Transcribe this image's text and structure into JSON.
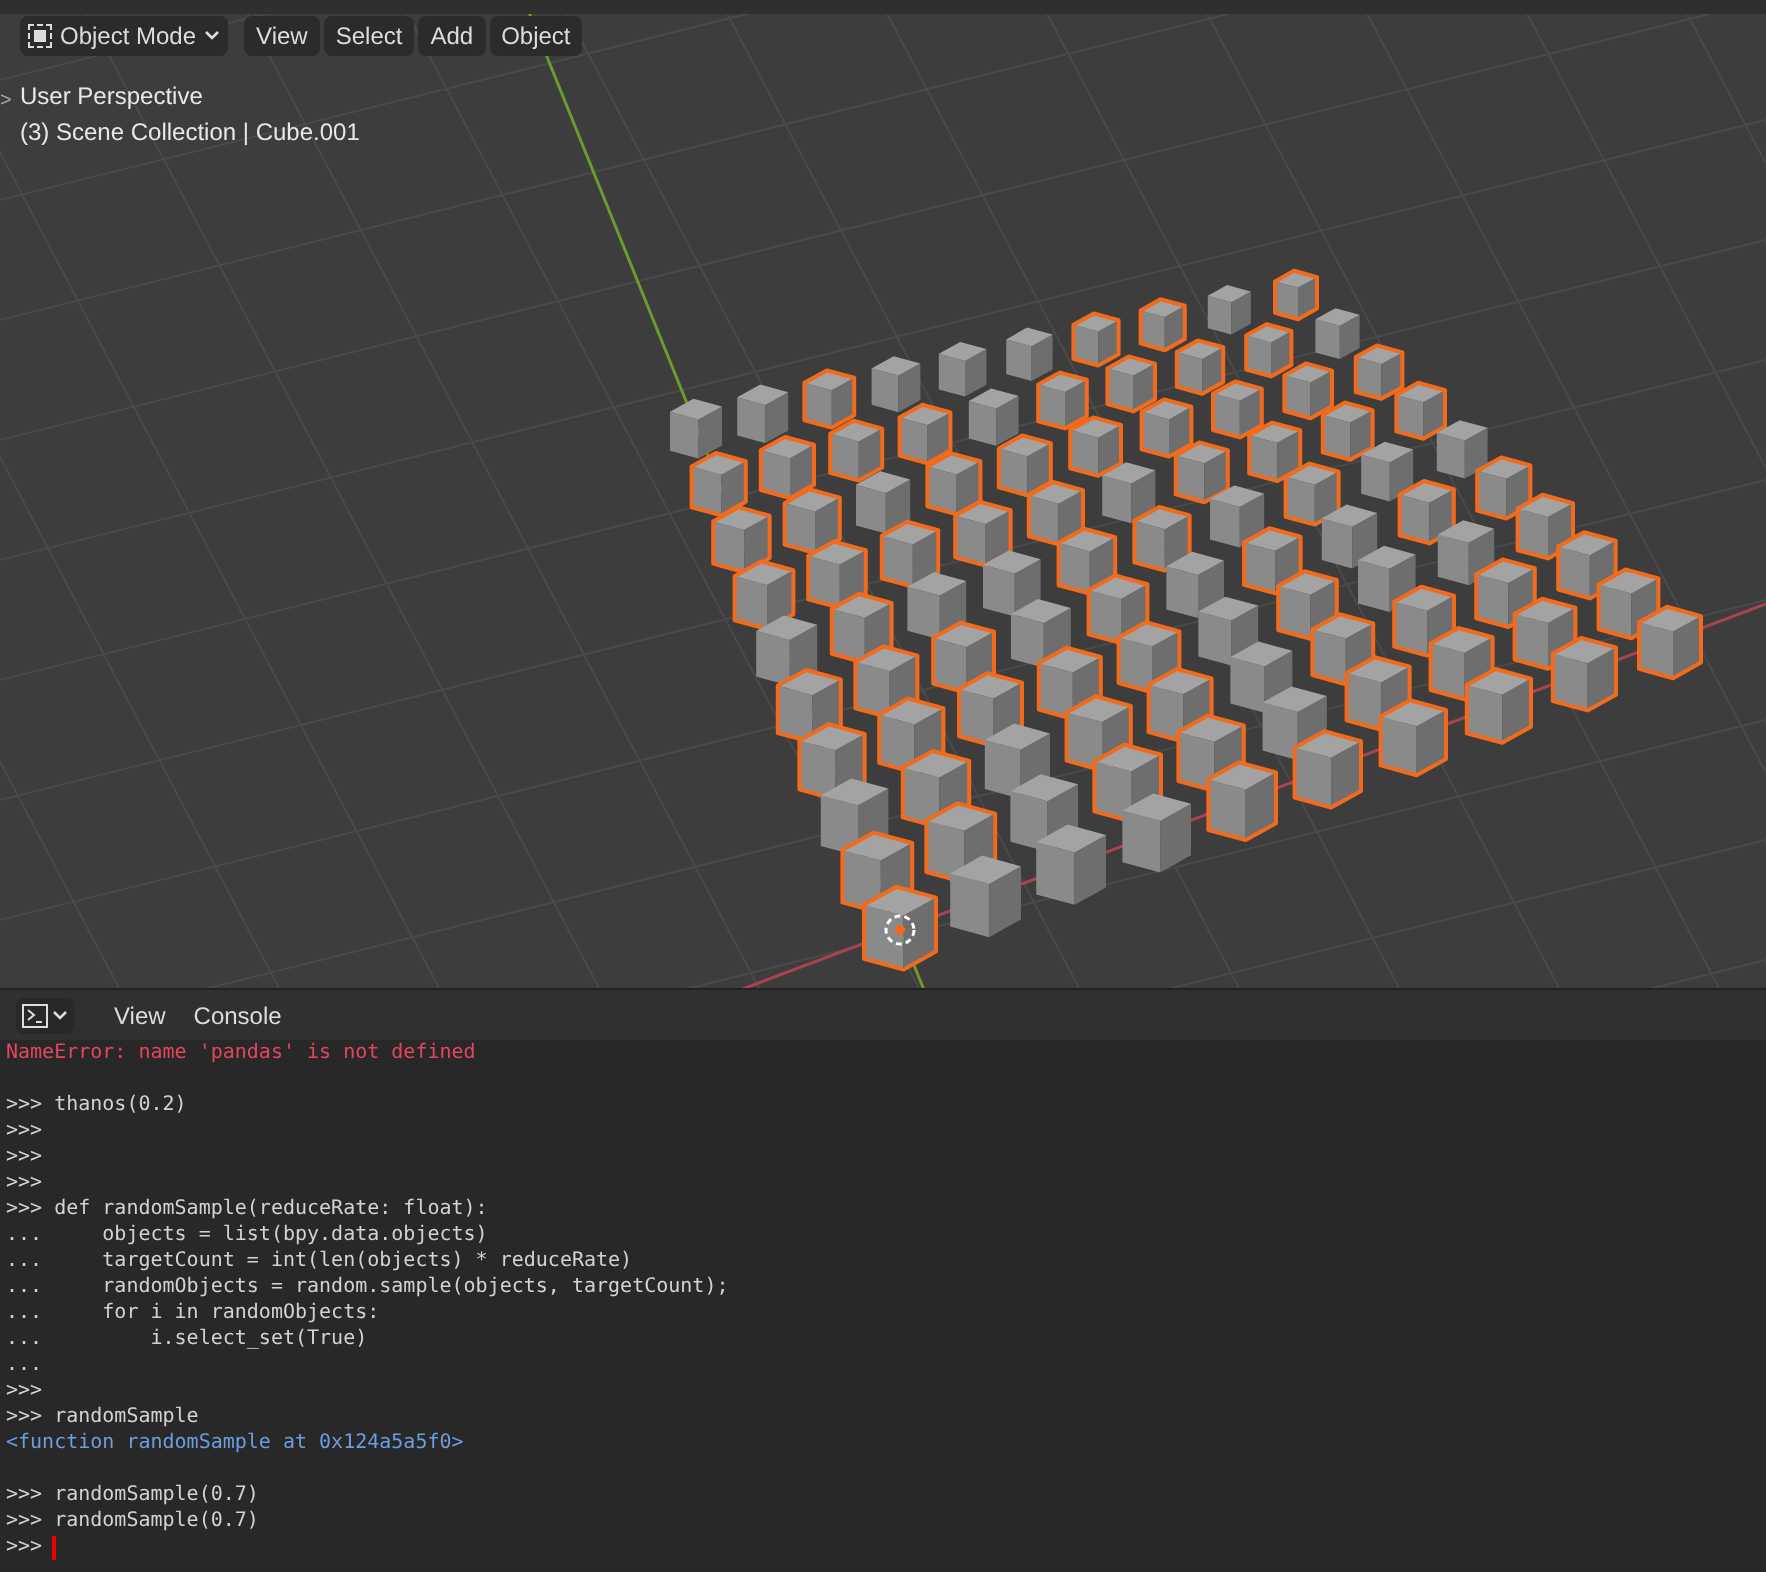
{
  "viewport": {
    "mode": "Object Mode",
    "menus": [
      "View",
      "Select",
      "Add",
      "Object"
    ],
    "overlay_lines": [
      "User Perspective",
      "(3) Scene Collection | Cube.001"
    ],
    "sidebar_toggle": ">",
    "rows": [
      {
        "cubes": [
          {
            "selected": false
          },
          {
            "selected": false
          },
          {
            "selected": true
          },
          {
            "selected": false
          },
          {
            "selected": false
          },
          {
            "selected": false
          },
          {
            "selected": true
          },
          {
            "selected": true
          },
          {
            "selected": false
          },
          {
            "selected": true
          }
        ]
      },
      {
        "cubes": [
          {
            "selected": true
          },
          {
            "selected": true
          },
          {
            "selected": true
          },
          {
            "selected": true
          },
          {
            "selected": false
          },
          {
            "selected": true
          },
          {
            "selected": true
          },
          {
            "selected": true
          },
          {
            "selected": true
          },
          {
            "selected": false
          }
        ]
      },
      {
        "cubes": [
          {
            "selected": true
          },
          {
            "selected": true
          },
          {
            "selected": false
          },
          {
            "selected": true
          },
          {
            "selected": true
          },
          {
            "selected": true
          },
          {
            "selected": true
          },
          {
            "selected": true
          },
          {
            "selected": true
          },
          {
            "selected": true
          }
        ]
      },
      {
        "cubes": [
          {
            "selected": true
          },
          {
            "selected": true
          },
          {
            "selected": true
          },
          {
            "selected": true
          },
          {
            "selected": true
          },
          {
            "selected": false
          },
          {
            "selected": true
          },
          {
            "selected": true
          },
          {
            "selected": true
          },
          {
            "selected": true
          }
        ]
      },
      {
        "cubes": [
          {
            "selected": false
          },
          {
            "selected": true
          },
          {
            "selected": false
          },
          {
            "selected": false
          },
          {
            "selected": true
          },
          {
            "selected": true
          },
          {
            "selected": false
          },
          {
            "selected": true
          },
          {
            "selected": false
          },
          {
            "selected": false
          }
        ]
      },
      {
        "cubes": [
          {
            "selected": true
          },
          {
            "selected": true
          },
          {
            "selected": true
          },
          {
            "selected": false
          },
          {
            "selected": true
          },
          {
            "selected": false
          },
          {
            "selected": true
          },
          {
            "selected": false
          },
          {
            "selected": true
          },
          {
            "selected": true
          }
        ]
      },
      {
        "cubes": [
          {
            "selected": true
          },
          {
            "selected": true
          },
          {
            "selected": true
          },
          {
            "selected": true
          },
          {
            "selected": true
          },
          {
            "selected": false
          },
          {
            "selected": true
          },
          {
            "selected": false
          },
          {
            "selected": false
          },
          {
            "selected": true
          }
        ]
      },
      {
        "cubes": [
          {
            "selected": false
          },
          {
            "selected": true
          },
          {
            "selected": false
          },
          {
            "selected": true
          },
          {
            "selected": true
          },
          {
            "selected": false
          },
          {
            "selected": true
          },
          {
            "selected": true
          },
          {
            "selected": true
          },
          {
            "selected": true
          }
        ]
      },
      {
        "cubes": [
          {
            "selected": true
          },
          {
            "selected": true
          },
          {
            "selected": false
          },
          {
            "selected": true
          },
          {
            "selected": true
          },
          {
            "selected": false
          },
          {
            "selected": true
          },
          {
            "selected": true
          },
          {
            "selected": true
          },
          {
            "selected": true
          }
        ]
      },
      {
        "cubes": [
          {
            "selected": true
          },
          {
            "selected": false
          },
          {
            "selected": false
          },
          {
            "selected": false
          },
          {
            "selected": true
          },
          {
            "selected": true
          },
          {
            "selected": true
          },
          {
            "selected": true
          },
          {
            "selected": true
          },
          {
            "selected": true
          }
        ]
      }
    ]
  },
  "console": {
    "menus": [
      "View",
      "Console"
    ],
    "lines": [
      {
        "kind": "error",
        "text": "NameError: name 'pandas' is not defined"
      },
      {
        "kind": "blank"
      },
      {
        "kind": "input",
        "text": ">>> thanos(0.2)"
      },
      {
        "kind": "input",
        "text": ">>>"
      },
      {
        "kind": "input",
        "text": ">>>"
      },
      {
        "kind": "input",
        "text": ">>>"
      },
      {
        "kind": "input",
        "text": ">>> def randomSample(reduceRate: float):"
      },
      {
        "kind": "input",
        "text": "...     objects = list(bpy.data.objects)"
      },
      {
        "kind": "input",
        "text": "...     targetCount = int(len(objects) * reduceRate)"
      },
      {
        "kind": "input",
        "text": "...     randomObjects = random.sample(objects, targetCount);"
      },
      {
        "kind": "input",
        "text": "...     for i in randomObjects:"
      },
      {
        "kind": "input",
        "text": "...         i.select_set(True)"
      },
      {
        "kind": "input",
        "text": "..."
      },
      {
        "kind": "input",
        "text": ">>>"
      },
      {
        "kind": "input",
        "text": ">>> randomSample"
      },
      {
        "kind": "output",
        "text": "<function randomSample at 0x124a5a5f0>"
      },
      {
        "kind": "blank"
      },
      {
        "kind": "input",
        "text": ">>> randomSample(0.7)"
      },
      {
        "kind": "input",
        "text": ">>> randomSample(0.7)"
      }
    ],
    "prompt": ">>>"
  }
}
